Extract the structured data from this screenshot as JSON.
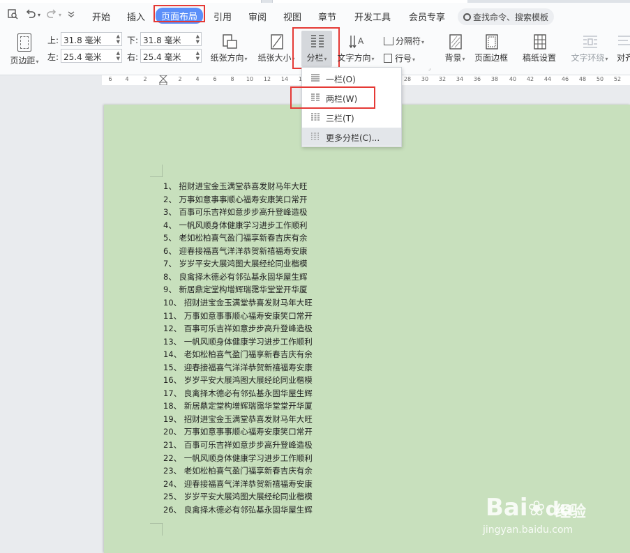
{
  "menubar": {
    "tabs": [
      "开始",
      "插入",
      "页面布局",
      "引用",
      "审阅",
      "视图",
      "章节",
      "开发工具",
      "会员专享"
    ],
    "active_tab": "页面布局",
    "search_label": "查找命令、搜索模板"
  },
  "ribbon": {
    "page_margin": "页边距",
    "margin_top_label": "上:",
    "margin_top": "31.8 毫米",
    "margin_bottom_label": "下:",
    "margin_bottom": "31.8 毫米",
    "margin_left_label": "左:",
    "margin_left": "25.4 毫米",
    "margin_right_label": "右:",
    "margin_right": "25.4 毫米",
    "orientation": "纸张方向",
    "paper_size": "纸张大小",
    "columns": "分栏",
    "text_direction": "文字方向",
    "separator": "分隔符",
    "line_number": "行号",
    "background": "背景",
    "page_border": "页面边框",
    "draft_settings": "稿纸设置",
    "text_wrap": "文字环绕",
    "align": "对齐"
  },
  "columns_menu": {
    "items": [
      "一栏(O)",
      "两栏(W)",
      "三栏(T)",
      "更多分栏(C)..."
    ],
    "highlighted": "两栏(W)"
  },
  "ruler": {
    "ticks": [
      "6",
      "4",
      "2",
      "2",
      "4",
      "6",
      "8",
      "10",
      "12",
      "14",
      "16",
      "18",
      "20",
      "22",
      "24",
      "26",
      "28",
      "30",
      "32",
      "34",
      "36",
      "38",
      "40",
      "42",
      "44",
      "46",
      "48",
      "50",
      "52"
    ]
  },
  "document": {
    "lines": [
      "1、 招财进宝金玉满堂恭喜发财马年大旺",
      "2、 万事如意事事顺心福寿安康笑口常开",
      "3、 百事可乐吉祥如意步步高升登峰造极",
      "4、 一帆风顺身体健康学习进步工作顺利",
      "5、 老如松柏喜气盈门福享新春吉庆有余",
      "6、 迎春接福喜气洋洋恭贺新禧福寿安康",
      "7、 岁岁平安大展鸿图大展经纶同业楷模",
      "8、 良禽择木德必有邻弘基永固华屋生辉",
      "9、 新居鼎定堂构增辉瑞霭华堂堂开华厦",
      "10、 招财进宝金玉满堂恭喜发财马年大旺",
      "11、 万事如意事事顺心福寿安康笑口常开",
      "12、 百事可乐吉祥如意步步高升登峰造极",
      "13、 一帆风顺身体健康学习进步工作顺利",
      "14、 老如松柏喜气盈门福享新春吉庆有余",
      "15、 迎春接福喜气洋洋恭贺新禧福寿安康",
      "16、 岁岁平安大展鸿图大展经纶同业楷模",
      "17、 良禽择木德必有邻弘基永固华屋生辉",
      "18、 新居鼎定堂构增辉瑞霭华堂堂开华厦",
      "19、 招财进宝金玉满堂恭喜发财马年大旺",
      "20、 万事如意事事顺心福寿安康笑口常开",
      "21、 百事可乐吉祥如意步步高升登峰造极",
      "22、 一帆风顺身体健康学习进步工作顺利",
      "23、 老如松柏喜气盈门福享新春吉庆有余",
      "24、 迎春接福喜气洋洋恭贺新禧福寿安康",
      "25、 岁岁平安大展鸿图大展经纶同业楷模",
      "26、 良禽择木德必有邻弘基永固华屋生辉"
    ]
  },
  "watermark": {
    "brand": "Bai",
    "brand_cn": "经验",
    "url": "jingyan.baidu.com"
  },
  "colors": {
    "accent": "#5b8ff9",
    "highlight_box": "#e53935",
    "page_bg": "#c8e0bd"
  }
}
